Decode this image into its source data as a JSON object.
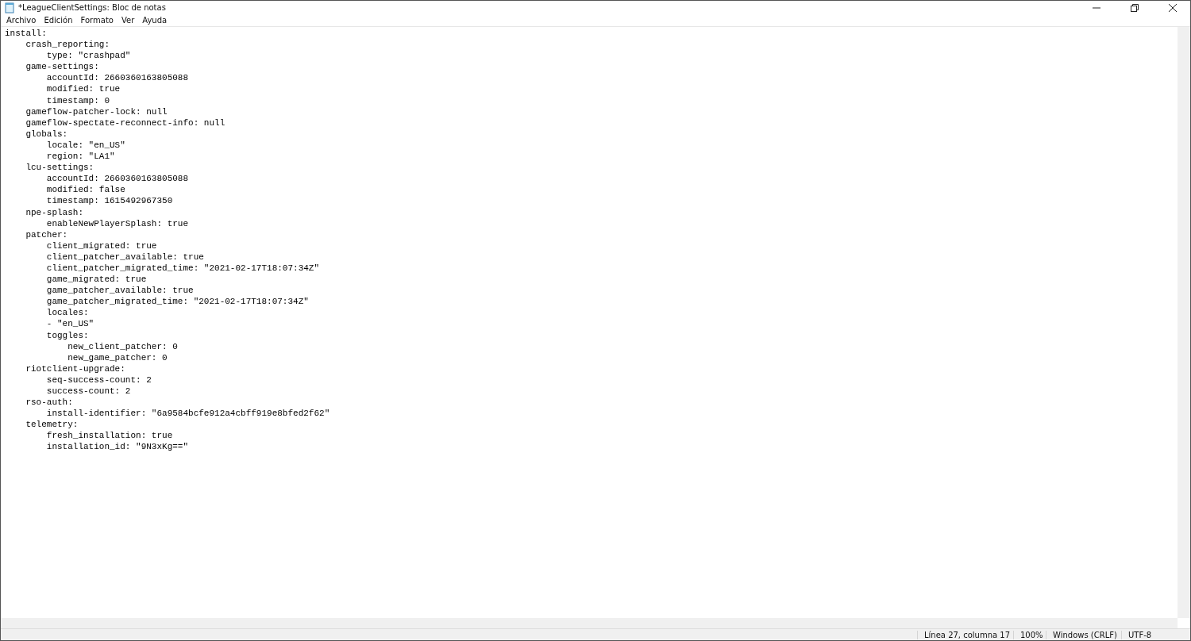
{
  "window": {
    "title": "*LeagueClientSettings: Bloc de notas"
  },
  "menu": [
    "Archivo",
    "Edición",
    "Formato",
    "Ver",
    "Ayuda"
  ],
  "editor": {
    "lines": [
      "install:",
      "    crash_reporting:",
      "        type: \"crashpad\"",
      "    game-settings:",
      "        accountId: 2660360163805088",
      "        modified: true",
      "        timestamp: 0",
      "    gameflow-patcher-lock: null",
      "    gameflow-spectate-reconnect-info: null",
      "    globals:",
      "        locale: \"en_US\"",
      "        region: \"LA1\"",
      "    lcu-settings:",
      "        accountId: 2660360163805088",
      "        modified: false",
      "        timestamp: 1615492967350",
      "    npe-splash:",
      "        enableNewPlayerSplash: true",
      "    patcher:",
      "        client_migrated: true",
      "        client_patcher_available: true",
      "        client_patcher_migrated_time: \"2021-02-17T18:07:34Z\"",
      "        game_migrated: true",
      "        game_patcher_available: true",
      "        game_patcher_migrated_time: \"2021-02-17T18:07:34Z\"",
      "        locales:",
      "        - \"en_US\"",
      "        toggles:",
      "            new_client_patcher: 0",
      "            new_game_patcher: 0",
      "    riotclient-upgrade:",
      "        seq-success-count: 2",
      "        success-count: 2",
      "    rso-auth:",
      "        install-identifier: \"6a9584bcfe912a4cbff919e8bfed2f62\"",
      "    telemetry:",
      "        fresh_installation: true",
      "        installation_id: \"9N3xKg==\""
    ]
  },
  "status_bar": [
    "Línea 27, columna 17",
    "100%",
    "Windows (CRLF)",
    "UTF-8"
  ]
}
